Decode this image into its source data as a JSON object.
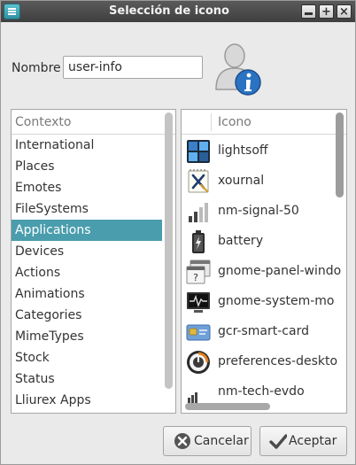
{
  "window": {
    "title": "Selección de icono",
    "menu_icon": "menu-icon",
    "controls": [
      "minimize-icon",
      "maximize-icon",
      "close-icon"
    ]
  },
  "name_row": {
    "label": "Nombre",
    "value": "user-info",
    "preview_icon": "user-info-icon"
  },
  "context": {
    "header": "Contexto",
    "items": [
      "International",
      "Places",
      "Emotes",
      "FileSystems",
      "Applications",
      "Devices",
      "Actions",
      "Animations",
      "Categories",
      "MimeTypes",
      "Stock",
      "Status",
      "Lliurex Apps"
    ],
    "selected": "Applications"
  },
  "icons": {
    "header": "Icono",
    "items": [
      {
        "name": "lightsoff",
        "icon": "lightsoff-icon"
      },
      {
        "name": "xournal",
        "icon": "xournal-icon"
      },
      {
        "name": "nm-signal-50",
        "icon": "signal-icon"
      },
      {
        "name": "battery",
        "icon": "battery-icon"
      },
      {
        "name": "gnome-panel-windo",
        "icon": "panel-window-icon"
      },
      {
        "name": "gnome-system-mo",
        "icon": "system-monitor-icon"
      },
      {
        "name": "gcr-smart-card",
        "icon": "smart-card-icon"
      },
      {
        "name": "preferences-deskto",
        "icon": "preferences-desktop-icon"
      },
      {
        "name": "nm-tech-evdo",
        "icon": "tech-evdo-icon"
      }
    ]
  },
  "buttons": {
    "cancel": "Cancelar",
    "accept": "Aceptar"
  }
}
